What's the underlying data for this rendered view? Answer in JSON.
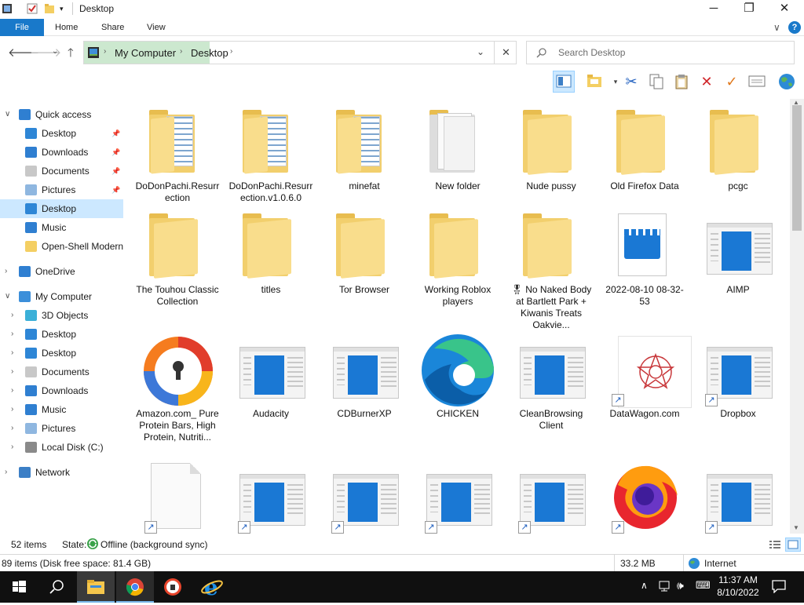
{
  "window": {
    "title": "Desktop",
    "controls": {
      "minimize": "─",
      "maximize": "❐",
      "close": "✕"
    }
  },
  "ribbon": {
    "tabs": [
      "File",
      "Home",
      "Share",
      "View"
    ],
    "collapse_icon": "∨",
    "help_icon": "?"
  },
  "address": {
    "root_icon": "desktop-icon",
    "crumbs": [
      "My Computer",
      "Desktop"
    ],
    "search_placeholder": "Search Desktop"
  },
  "colors": {
    "accent": "#1979ca",
    "selection": "#cce8ff",
    "address_highlight": "#cce8cf",
    "folder": "#f9dd8c",
    "app_blue": "#1a78d4"
  },
  "nav_pane": {
    "items": [
      {
        "label": "Quick access",
        "icon": "star-icon",
        "chevron": "∨",
        "pinned": false,
        "indent": 0
      },
      {
        "label": "Desktop",
        "icon": "desktop-icon",
        "pinned": true,
        "indent": 1
      },
      {
        "label": "Downloads",
        "icon": "download-icon",
        "pinned": true,
        "indent": 1
      },
      {
        "label": "Documents",
        "icon": "document-icon",
        "pinned": true,
        "indent": 1
      },
      {
        "label": "Pictures",
        "icon": "picture-icon",
        "pinned": true,
        "indent": 1
      },
      {
        "label": "Desktop",
        "icon": "desktop-icon",
        "pinned": false,
        "indent": 1,
        "selected": true
      },
      {
        "label": "Music",
        "icon": "music-icon",
        "pinned": false,
        "indent": 1
      },
      {
        "label": "Open-Shell Modern",
        "icon": "folder-icon",
        "pinned": false,
        "indent": 1
      },
      {
        "label": "OneDrive",
        "icon": "cloud-icon",
        "chevron": "›",
        "indent": 0
      },
      {
        "label": "My Computer",
        "icon": "computer-icon",
        "chevron": "∨",
        "indent": 0
      },
      {
        "label": "3D Objects",
        "icon": "cube-icon",
        "chevron": "›",
        "indent": 1
      },
      {
        "label": "Desktop",
        "icon": "desktop-icon",
        "chevron": "›",
        "indent": 1
      },
      {
        "label": "Desktop",
        "icon": "desktop-icon",
        "chevron": "›",
        "indent": 1
      },
      {
        "label": "Documents",
        "icon": "document-icon",
        "chevron": "›",
        "indent": 1
      },
      {
        "label": "Downloads",
        "icon": "download-icon",
        "chevron": "›",
        "indent": 1
      },
      {
        "label": "Music",
        "icon": "music-icon",
        "chevron": "›",
        "indent": 1
      },
      {
        "label": "Pictures",
        "icon": "picture-icon",
        "chevron": "›",
        "indent": 1
      },
      {
        "label": "Local Disk (C:)",
        "icon": "disk-icon",
        "chevron": "›",
        "indent": 1
      },
      {
        "label": "Network",
        "icon": "network-icon",
        "chevron": "›",
        "indent": 0
      }
    ]
  },
  "files": [
    {
      "name": "DoDonPachi.Resurrection",
      "kind": "folder-docs"
    },
    {
      "name": "DoDonPachi.Resurrection.v1.0.6.0",
      "kind": "folder-docs"
    },
    {
      "name": "minefat",
      "kind": "folder-docs"
    },
    {
      "name": "New folder",
      "kind": "folder-blank"
    },
    {
      "name": "Nude pussy",
      "kind": "folder"
    },
    {
      "name": "Old Firefox Data",
      "kind": "folder"
    },
    {
      "name": "pcgc",
      "kind": "folder"
    },
    {
      "name": "The Touhou Classic Collection",
      "kind": "folder"
    },
    {
      "name": "titles",
      "kind": "folder"
    },
    {
      "name": "Tor Browser",
      "kind": "folder"
    },
    {
      "name": "Working Roblox players",
      "kind": "folder"
    },
    {
      "name": "🎖 No Naked Body at Bartlett Park + Kiwanis Treats Oakvie...",
      "kind": "folder"
    },
    {
      "name": "2022-08-10 08-32-53",
      "kind": "video"
    },
    {
      "name": "AIMP",
      "kind": "app"
    },
    {
      "name": "Amazon.com_ Pure Protein Bars, High Protein, Nutriti...",
      "kind": "avast"
    },
    {
      "name": "Audacity",
      "kind": "app"
    },
    {
      "name": "CDBurnerXP",
      "kind": "app"
    },
    {
      "name": "CHICKEN",
      "kind": "edge"
    },
    {
      "name": "CleanBrowsing Client",
      "kind": "app"
    },
    {
      "name": "DataWagon.com",
      "kind": "datawagon",
      "shortcut": true
    },
    {
      "name": "Dropbox",
      "kind": "app",
      "shortcut": true
    },
    {
      "name": "",
      "kind": "blank-doc",
      "shortcut": true
    },
    {
      "name": "",
      "kind": "app",
      "shortcut": true
    },
    {
      "name": "",
      "kind": "app",
      "shortcut": true
    },
    {
      "name": "",
      "kind": "app",
      "shortcut": true
    },
    {
      "name": "",
      "kind": "app",
      "shortcut": true
    },
    {
      "name": "",
      "kind": "firefox",
      "shortcut": true
    },
    {
      "name": "",
      "kind": "app",
      "shortcut": true
    }
  ],
  "status": {
    "item_count": "52 items",
    "state_label": "State:",
    "state_value": "Offline (background sync)"
  },
  "info_bar": {
    "summary": "89 items (Disk free space: 81.4 GB)",
    "size": "33.2 MB",
    "zone": "Internet"
  },
  "taskbar": {
    "time": "11:37 AM",
    "date": "8/10/2022"
  }
}
